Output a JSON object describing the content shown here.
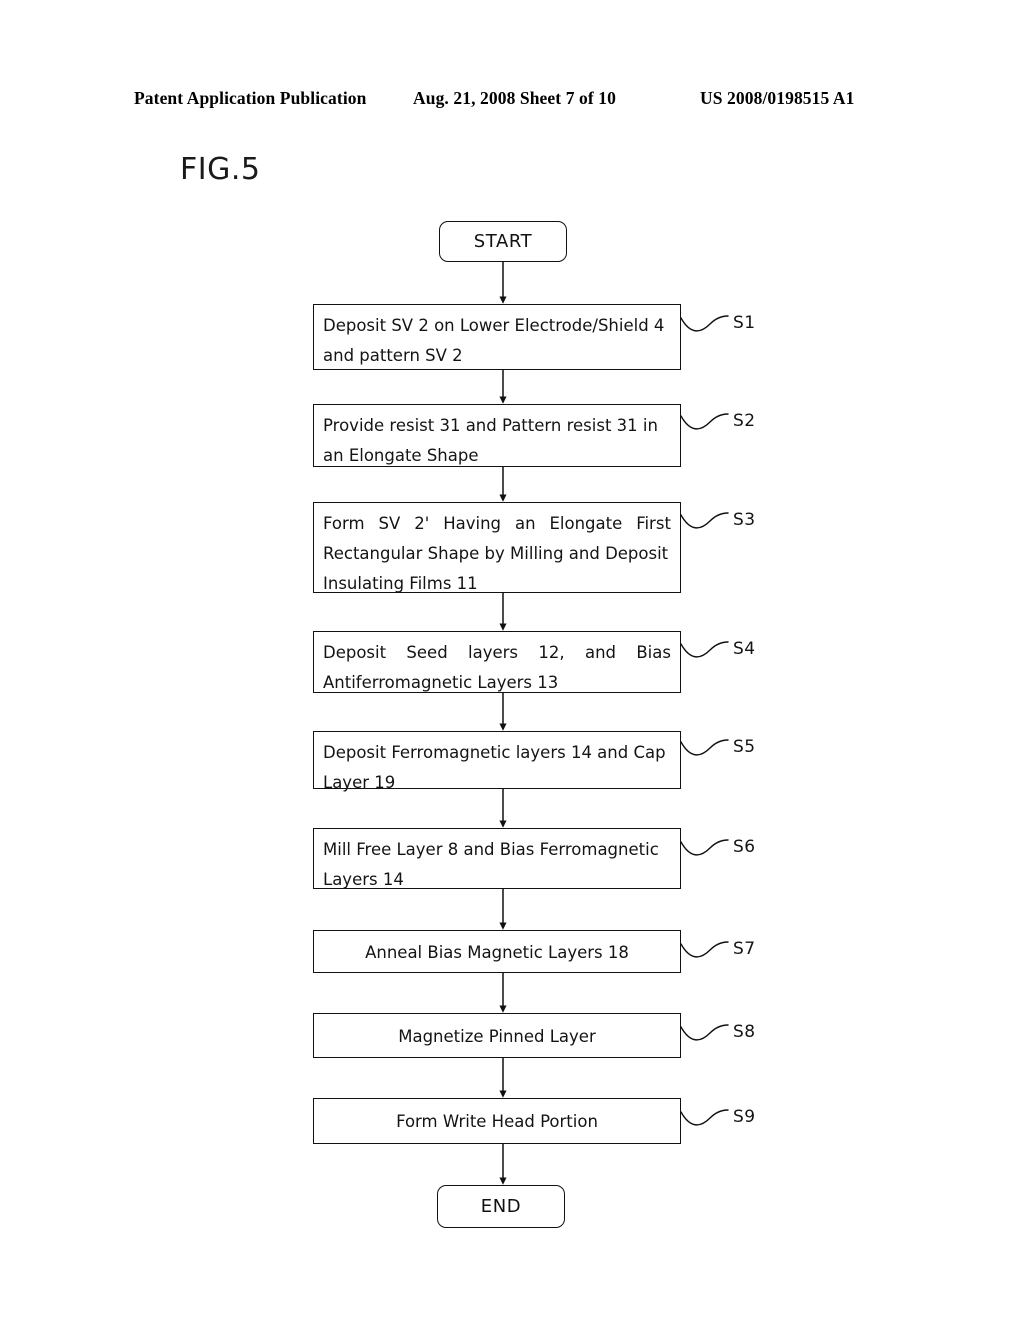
{
  "header": {
    "left": "Patent Application Publication",
    "middle": "Aug. 21, 2008  Sheet 7 of 10",
    "right": "US 2008/0198515 A1"
  },
  "figure": {
    "label": "FIG.5"
  },
  "flowchart": {
    "start_label": "START",
    "end_label": "END",
    "steps": [
      {
        "tag": "S1",
        "lines": [
          "Deposit SV 2 on Lower Electrode/Shield 4",
          "and pattern SV 2"
        ],
        "align": "left"
      },
      {
        "tag": "S2",
        "lines": [
          "Provide resist 31 and Pattern resist 31 in",
          "an Elongate Shape"
        ],
        "align": "left"
      },
      {
        "tag": "S3",
        "lines": [
          "Form SV 2' Having an Elongate First",
          "Rectangular Shape by Milling and Deposit",
          "Insulating Films 11"
        ],
        "align": "justify"
      },
      {
        "tag": "S4",
        "lines": [
          "Deposit Seed layers 12, and Bias",
          "Antiferromagnetic Layers 13"
        ],
        "align": "justify"
      },
      {
        "tag": "S5",
        "lines": [
          "Deposit Ferromagnetic layers 14 and Cap",
          "Layer 19"
        ],
        "align": "left"
      },
      {
        "tag": "S6",
        "lines": [
          "Mill Free Layer 8 and Bias Ferromagnetic",
          "Layers 14"
        ],
        "align": "left"
      },
      {
        "tag": "S7",
        "lines": [
          "Anneal Bias Magnetic Layers 18"
        ],
        "align": "center"
      },
      {
        "tag": "S8",
        "lines": [
          "Magnetize Pinned Layer"
        ],
        "align": "center"
      },
      {
        "tag": "S9",
        "lines": [
          "Form Write Head Portion"
        ],
        "align": "center"
      }
    ]
  },
  "colors": {
    "ink": "#111111",
    "page": "#ffffff"
  }
}
